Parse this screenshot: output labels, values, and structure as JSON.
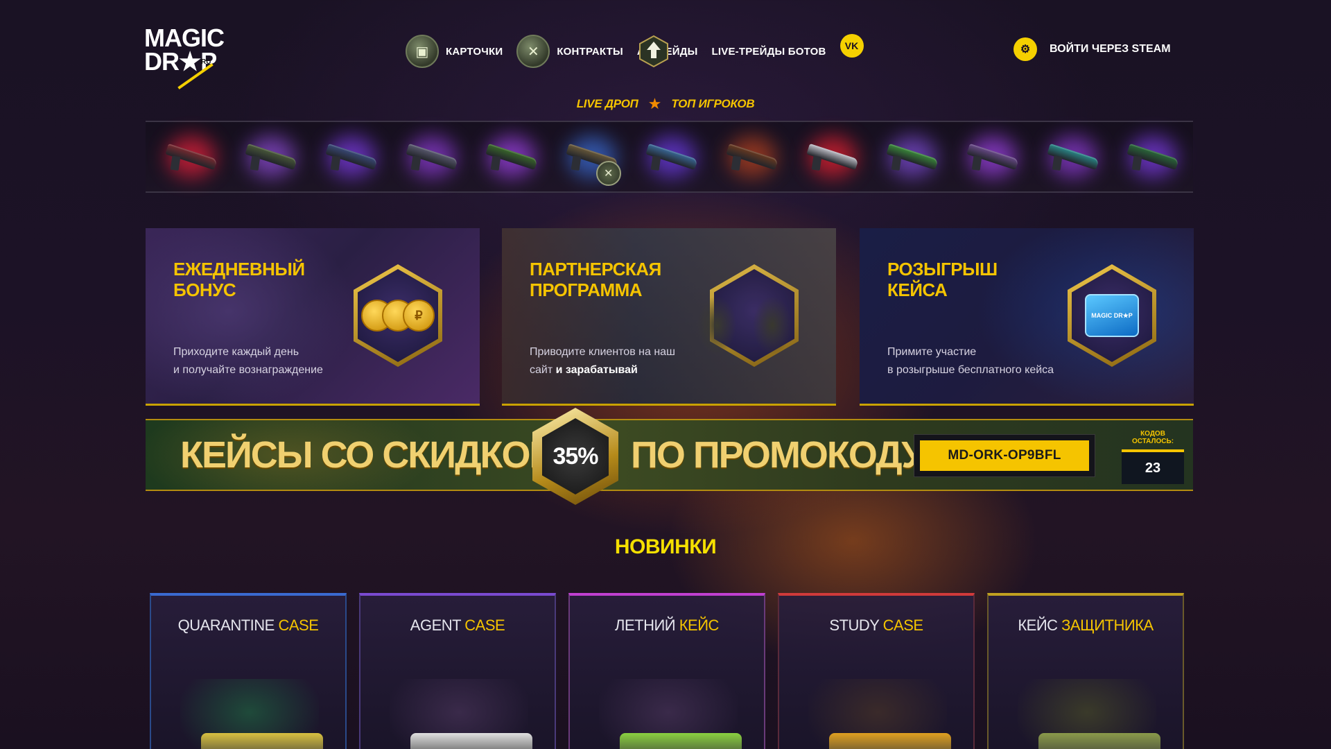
{
  "brand": {
    "logo_line1": "MAGIC",
    "logo_line2": "DR★P",
    "logo_ru": "RU"
  },
  "nav": {
    "items": [
      {
        "label": "КАРТОЧКИ",
        "icon": "cards-icon"
      },
      {
        "label": "КОНТРАКТЫ",
        "icon": "contract-icon"
      },
      {
        "label": "АПГРЕЙДЫ",
        "icon": "upgrade-icon"
      },
      {
        "label": "LIVE-ТРЕЙДЫ БОТОВ",
        "icon": ""
      }
    ],
    "vk_label": "VK",
    "login_label": "ВОЙТИ ЧЕРЕЗ STEAM"
  },
  "live_tabs": {
    "live_drop": "LIVE ДРОП",
    "top_players": "ТОП ИГРОКОВ"
  },
  "drops": [
    {
      "glow": "#e0203a",
      "gun": "#7a2a30"
    },
    {
      "glow": "#8a4ad0",
      "gun": "#4a5a3a"
    },
    {
      "glow": "#7a3ae0",
      "gun": "#3a4a7a"
    },
    {
      "glow": "#8a3ad0",
      "gun": "#5a5a70"
    },
    {
      "glow": "#9a40e0",
      "gun": "#3a6a2a"
    },
    {
      "glow": "#3a6ad0",
      "gun": "#6a5a3a",
      "contract": true
    },
    {
      "glow": "#6a3ae0",
      "gun": "#3a6a9a"
    },
    {
      "glow": "#b04020",
      "gun": "#6a3a20"
    },
    {
      "glow": "#e02030",
      "gun": "#c0c0c8"
    },
    {
      "glow": "#7a4ad0",
      "gun": "#3a8a3a"
    },
    {
      "glow": "#9a40e0",
      "gun": "#6a4a8a"
    },
    {
      "glow": "#8a3ad0",
      "gun": "#2a8a8a"
    },
    {
      "glow": "#7a3ae0",
      "gun": "#2a6a3a"
    }
  ],
  "cards": {
    "daily": {
      "title": "ЕЖЕДНЕВНЫЙ БОНУС",
      "desc_line1": "Приходите каждый день",
      "desc_line2": "и получайте вознаграждение",
      "coin_symbol": "₽"
    },
    "partner": {
      "title_line1": "ПАРТНЕРСКАЯ",
      "title_line2": "ПРОГРАММА",
      "desc_line1": "Приводите клиентов на наш",
      "desc_line2_plain": "сайт ",
      "desc_line2_bold": "и зарабатывай"
    },
    "giveaway": {
      "title": "РОЗЫГРЫШ КЕЙСА",
      "desc_line1": "Примите участие",
      "desc_line2": "в розыгрыше бесплатного кейса",
      "case_label": "MAGIC DR★P"
    }
  },
  "promo_banner": {
    "left_text": "КЕЙСЫ СО СКИДКОЙ",
    "discount": "35%",
    "right_text": "ПО ПРОМОКОДУ",
    "promo_code": "MD-ORK-OP9BFL",
    "codes_left_label": "КОДОВ ОСТАЛОСЬ:",
    "codes_left_count": "23"
  },
  "new_section": {
    "title": "НОВИНКИ"
  },
  "cases": [
    {
      "name_plain": "QUARANTINE ",
      "name_hl": "CASE",
      "border": "#2a4a8a",
      "top": "#3a6ad0",
      "art": "#1f4a3a",
      "box": "#d8c040"
    },
    {
      "name_plain": "AGENT ",
      "name_hl": "CASE",
      "border": "#4a3a7a",
      "top": "#7a4ad0",
      "art": "#3a2a4a",
      "box": "#e0e0e0"
    },
    {
      "name_plain": "ЛЕТНИЙ ",
      "name_hl": "КЕЙС",
      "border": "#6a3a7a",
      "top": "#c040d0",
      "art": "#3a2a4a",
      "box": "#8ad040"
    },
    {
      "name_plain": "STUDY ",
      "name_hl": "CASE",
      "border": "#5a2a3a",
      "top": "#d03a3a",
      "art": "#3a2a2a",
      "box": "#e0a020"
    },
    {
      "name_plain": "КЕЙС ",
      "name_hl": "ЗАЩИТНИКА",
      "border": "#6a5a2a",
      "top": "#c0a020",
      "art": "#3a3a2a",
      "box": "#8a9a4a"
    }
  ]
}
